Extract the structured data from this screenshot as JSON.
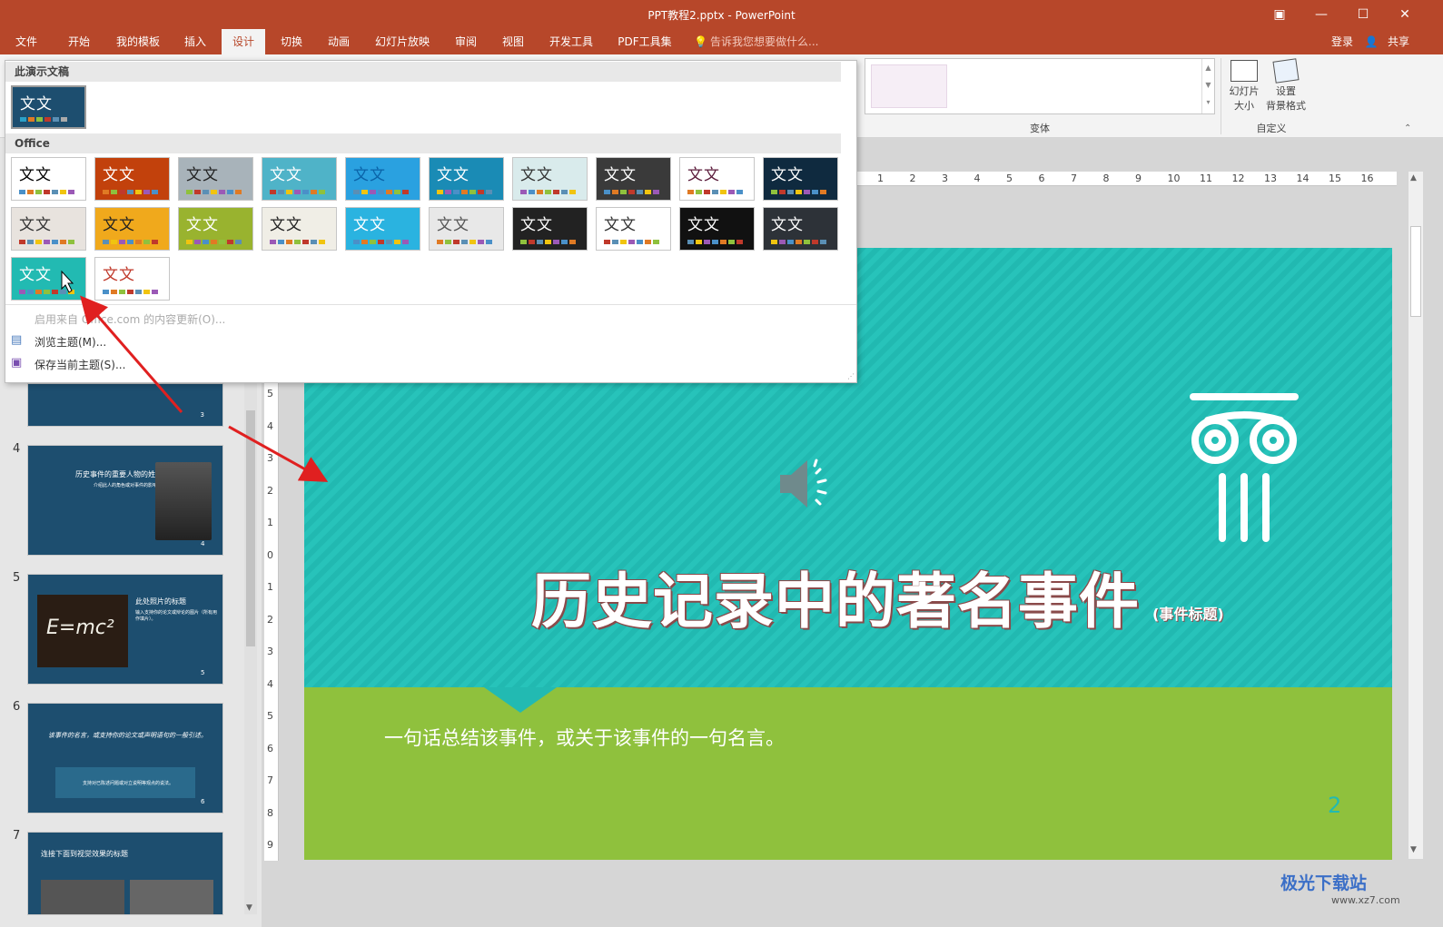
{
  "window": {
    "title": "PPT教程2.pptx - PowerPoint"
  },
  "tabs": [
    "文件",
    "开始",
    "我的模板",
    "插入",
    "设计",
    "切换",
    "动画",
    "幻灯片放映",
    "审阅",
    "视图",
    "开发工具",
    "PDF工具集"
  ],
  "tell_me": "告诉我您想要做什么...",
  "account": {
    "login": "登录",
    "share": "共享"
  },
  "ribbon": {
    "variants_label": "变体",
    "customize_label": "自定义",
    "slide_size_l1": "幻灯片",
    "slide_size_l2": "大小",
    "bg_format_l1": "设置",
    "bg_format_l2": "背景格式"
  },
  "gallery": {
    "section_this": "此演示文稿",
    "section_office": "Office",
    "sample_text": "文文",
    "menu_enable": "启用来自 Office.com 的内容更新(O)...",
    "menu_browse": "浏览主题(M)...",
    "menu_save": "保存当前主题(S)..."
  },
  "theme_colors": [
    {
      "bg": "#ffffff",
      "fg": "#000000"
    },
    {
      "bg": "#c2410c",
      "fg": "#ffffff"
    },
    {
      "bg": "#a8b3ba",
      "fg": "#222222"
    },
    {
      "bg": "#4fb3c8",
      "fg": "#ffffff"
    },
    {
      "bg": "#2aa1e0",
      "fg": "#0a63a8"
    },
    {
      "bg": "#1a8bb5",
      "fg": "#ffffff"
    },
    {
      "bg": "#d9ebec",
      "fg": "#333333"
    },
    {
      "bg": "#3a3a3a",
      "fg": "#ffffff"
    },
    {
      "bg": "#ffffff",
      "fg": "#5a1a3a"
    },
    {
      "bg": "#0f2a3f",
      "fg": "#ffffff"
    },
    {
      "bg": "#e8e3de",
      "fg": "#333333"
    },
    {
      "bg": "#f0a91c",
      "fg": "#222222"
    },
    {
      "bg": "#99b32f",
      "fg": "#ffffff"
    },
    {
      "bg": "#f0eee6",
      "fg": "#222222"
    },
    {
      "bg": "#2ab3e0",
      "fg": "#ffffff"
    },
    {
      "bg": "#e8e8e8",
      "fg": "#555555"
    },
    {
      "bg": "#222222",
      "fg": "#ffffff"
    },
    {
      "bg": "#ffffff",
      "fg": "#333333"
    },
    {
      "bg": "#111111",
      "fg": "#ffffff"
    },
    {
      "bg": "#2d3238",
      "fg": "#ffffff"
    },
    {
      "bg": "#22bab2",
      "fg": "#ffffff"
    },
    {
      "bg": "#ffffff",
      "fg": "#c0392b"
    }
  ],
  "slides": [
    {
      "num": "4",
      "title": "历史事件的重要人物的姓名",
      "sub": "介绍此人的角色或对事件的影响。",
      "page": "4"
    },
    {
      "num": "5",
      "title": "此处照片的标题",
      "sub": "输入支持你的论文或辩论的图片（所有用作填片）。",
      "page": "5",
      "formula": "E=mc²"
    },
    {
      "num": "6",
      "title": "该事件的名言，或支持你的论文或声明语句的一般引述。",
      "sub": "支持对已陈述问题或对立说明等观点的说法。",
      "page": "6"
    },
    {
      "num": "7",
      "title": "连接下面到视觉效果的标题",
      "page": "7"
    }
  ],
  "slide": {
    "title": "历史记录中的著名事件",
    "title_sub": "(事件标题)",
    "quote": "一句话总结该事件，或关于该事件的一句名言。",
    "number": "2"
  },
  "hruler_ticks": [
    "1",
    "2",
    "3",
    "4",
    "5",
    "6",
    "7",
    "8",
    "9",
    "10",
    "11",
    "12",
    "13",
    "14",
    "15",
    "16"
  ],
  "vruler_ticks": [
    "5",
    "4",
    "3",
    "2",
    "1",
    "0",
    "1",
    "2",
    "3",
    "4",
    "5",
    "6",
    "7",
    "8",
    "9"
  ],
  "watermark": {
    "name": "极光下载站",
    "url": "www.xz7.com"
  }
}
